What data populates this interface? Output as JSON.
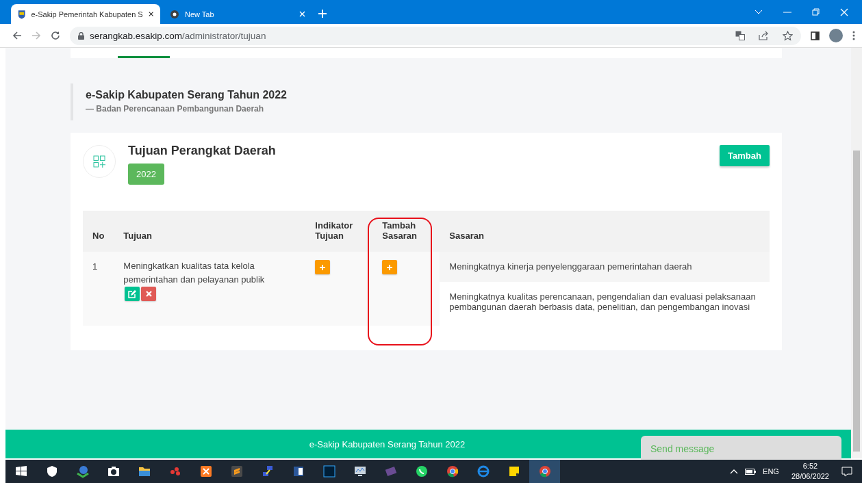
{
  "browser": {
    "tabs": [
      {
        "title": "e-Sakip Pemerintah Kabupaten S",
        "selected": true
      },
      {
        "title": "New Tab",
        "selected": false
      }
    ],
    "url_host": "serangkab.esakip.com",
    "url_path": "/administrator/tujuan"
  },
  "page_header": {
    "title": "e-Sakip Kabupaten Serang Tahun 2022",
    "subtitle": "— Badan Perencanaan Pembangunan Daerah"
  },
  "card": {
    "title": "Tujuan Perangkat Daerah",
    "year_badge": "2022",
    "add_button": "Tambah"
  },
  "table": {
    "columns": [
      "No",
      "Tujuan",
      "Indikator Tujuan",
      "Tambah Sasaran",
      "Sasaran"
    ],
    "rows": [
      {
        "no": "1",
        "tujuan": "Meningkatkan kualitas tata kelola pemerintahan dan pelayanan publik",
        "sasaran": [
          "Meningkatnya kinerja penyelenggaraan pemerintahan daerah",
          "Meningkatnya kualitas perencanaan, pengendalian dan evaluasi pelaksanaan pembangunan daerah berbasis data, penelitian, dan pengembangan inovasi"
        ]
      }
    ]
  },
  "footer": {
    "text": "e-Sakip Kabupaten Serang Tahun 2022"
  },
  "chat": {
    "placeholder": "Send message"
  },
  "taskbar": {
    "language": "ENG",
    "time": "6:52",
    "date": "28/06/2022"
  }
}
